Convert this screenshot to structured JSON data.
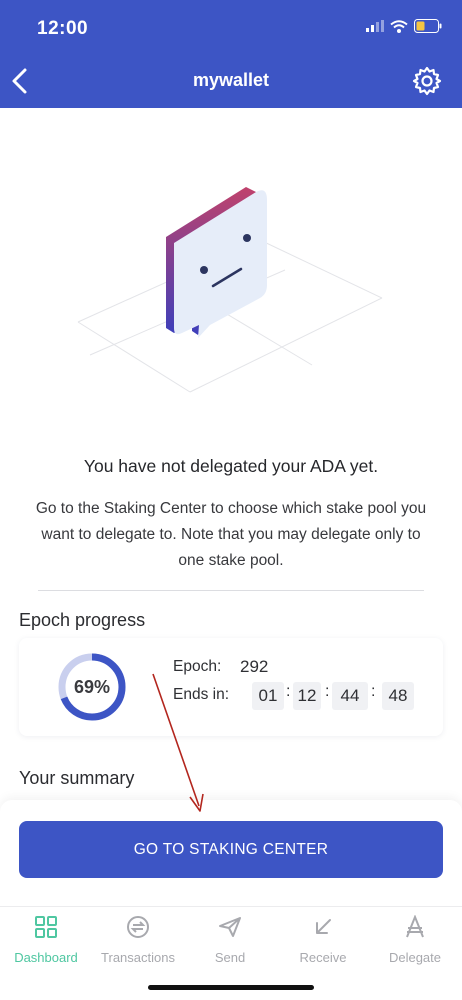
{
  "status_bar": {
    "time": "12:00"
  },
  "nav": {
    "title": "mywallet",
    "back_icon": "chevron-left-icon",
    "settings_icon": "gear-icon"
  },
  "empty_state": {
    "headline": "You have not delegated your ADA yet.",
    "description": "Go to the Staking Center to choose which stake pool you want to delegate to. Note that you may delegate only to one stake pool."
  },
  "epoch_progress": {
    "title": "Epoch progress",
    "percent_label": "69%",
    "progress": 0.69,
    "epoch_label": "Epoch:",
    "epoch_value": "292",
    "ends_label": "Ends in:",
    "ends_in": {
      "days": "01",
      "hours": "12",
      "minutes": "44",
      "seconds": "48"
    },
    "separator": ":"
  },
  "summary": {
    "title": "Your summary"
  },
  "cta": {
    "label": "GO TO STAKING CENTER"
  },
  "tabs": [
    {
      "label": "Dashboard",
      "icon": "dashboard-icon",
      "active": true
    },
    {
      "label": "Transactions",
      "icon": "transactions-icon",
      "active": false
    },
    {
      "label": "Send",
      "icon": "send-icon",
      "active": false
    },
    {
      "label": "Receive",
      "icon": "receive-icon",
      "active": false
    },
    {
      "label": "Delegate",
      "icon": "ada-icon",
      "active": false
    }
  ],
  "colors": {
    "primary": "#3d55c5",
    "active_tab": "#4fc7a1",
    "inactive_tab": "#a8a9ae",
    "annotation": "#b3261e"
  }
}
